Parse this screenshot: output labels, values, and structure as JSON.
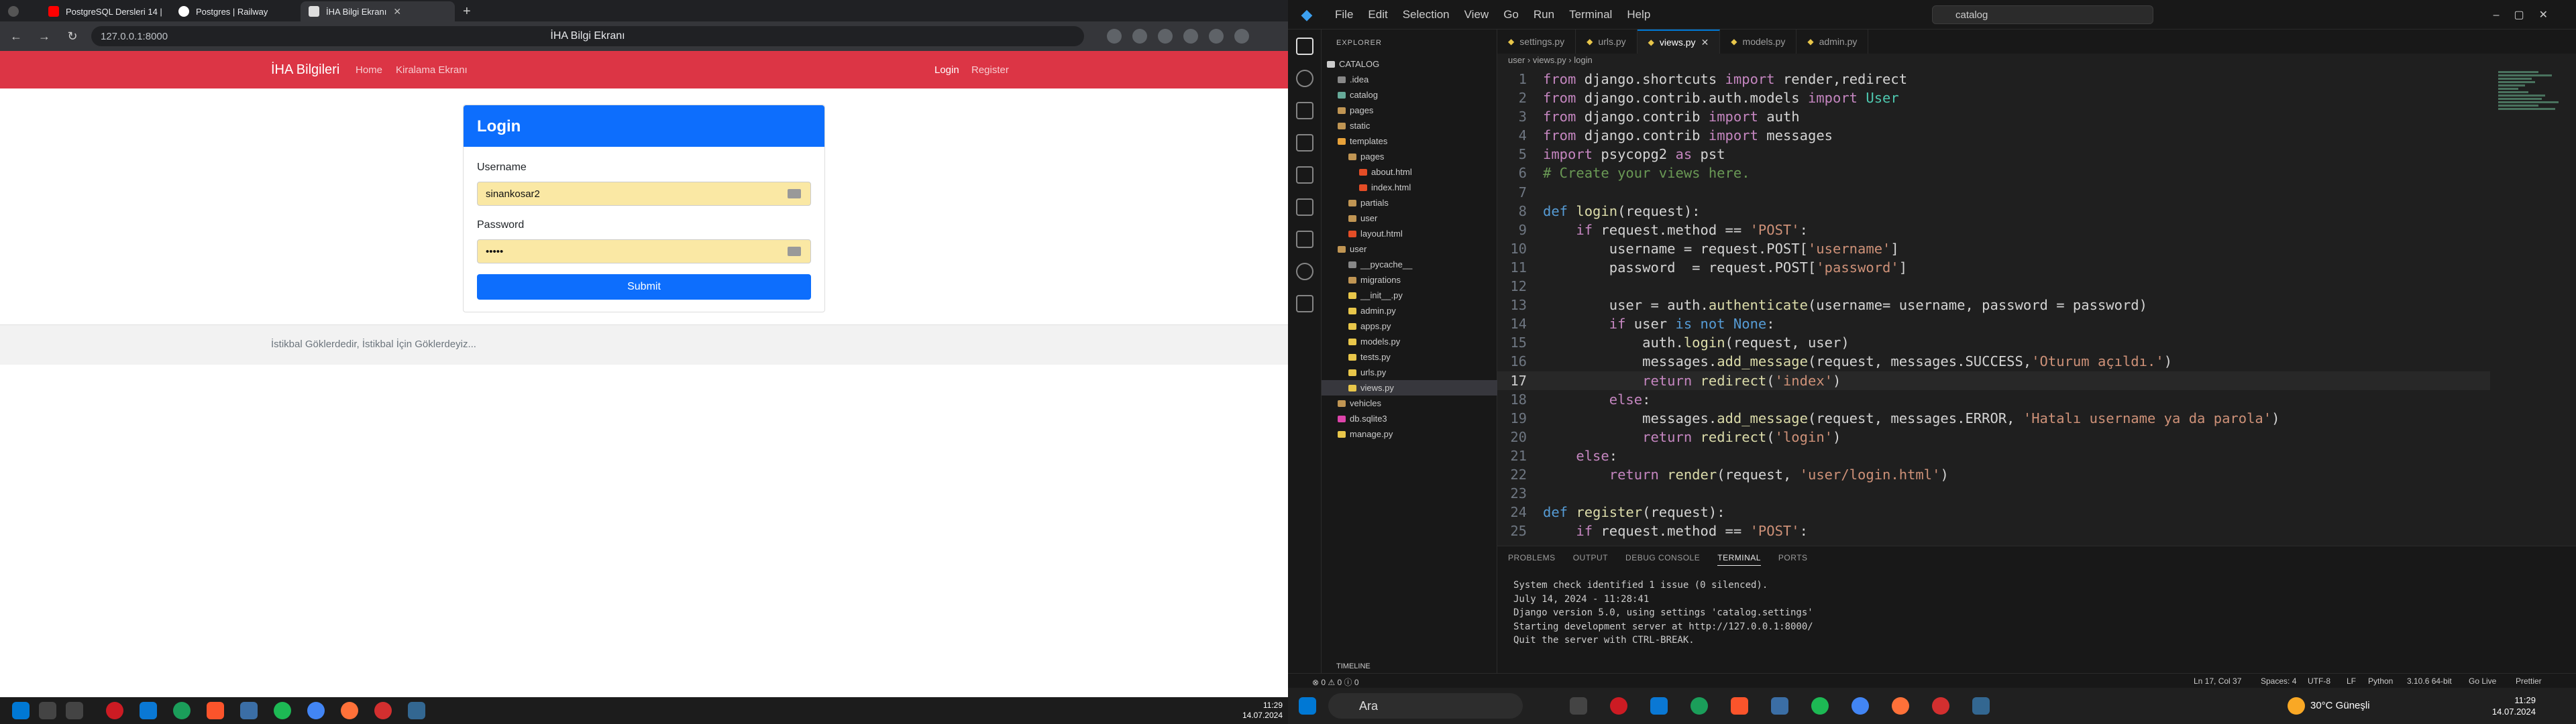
{
  "browser": {
    "tabs": [
      {
        "label": "PostgreSQL Dersleri 14 | D",
        "color": "#ff0000"
      },
      {
        "label": "Postgres | Railway",
        "color": "#ffffff"
      },
      {
        "label": "İHA Bilgi Ekranı",
        "color": "#ffffff"
      }
    ],
    "url": "127.0.0.1:8000",
    "page_title": "İHA Bilgi Ekranı"
  },
  "site": {
    "brand": "İHA Bilgileri",
    "nav": [
      "Home",
      "Kiralama Ekranı"
    ],
    "nav_right": [
      "Login",
      "Register"
    ],
    "card_title": "Login",
    "username_label": "Username",
    "username_value": "sinankosar2",
    "password_label": "Password",
    "password_value": "•••••",
    "submit": "Submit",
    "footer": "İstikbal Göklerdedir, İstikbal İçin Göklerdeyiz..."
  },
  "vscode": {
    "menu": [
      "File",
      "Edit",
      "Selection",
      "View",
      "Go",
      "Run",
      "Terminal",
      "Help"
    ],
    "search": "catalog",
    "explorer": "EXPLORER",
    "tree": [
      {
        "label": "CATALOG",
        "indent": 0,
        "c": "#ccc"
      },
      {
        "label": ".idea",
        "indent": 1,
        "c": "#888"
      },
      {
        "label": "catalog",
        "indent": 1,
        "c": "#6a9"
      },
      {
        "label": "pages",
        "indent": 1,
        "c": "#c09553"
      },
      {
        "label": "static",
        "indent": 1,
        "c": "#c09553"
      },
      {
        "label": "templates",
        "indent": 1,
        "c": "#e8a23a"
      },
      {
        "label": "pages",
        "indent": 2,
        "c": "#c09553"
      },
      {
        "label": "about.html",
        "indent": 3,
        "c": "#e44d26"
      },
      {
        "label": "index.html",
        "indent": 3,
        "c": "#e44d26"
      },
      {
        "label": "partials",
        "indent": 2,
        "c": "#c09553"
      },
      {
        "label": "user",
        "indent": 2,
        "c": "#c09553"
      },
      {
        "label": "layout.html",
        "indent": 2,
        "c": "#e44d26"
      },
      {
        "label": "user",
        "indent": 1,
        "c": "#c09553"
      },
      {
        "label": "__pycache__",
        "indent": 2,
        "c": "#888"
      },
      {
        "label": "migrations",
        "indent": 2,
        "c": "#c09553"
      },
      {
        "label": "__init__.py",
        "indent": 2,
        "c": "#e8c64a"
      },
      {
        "label": "admin.py",
        "indent": 2,
        "c": "#e8c64a"
      },
      {
        "label": "apps.py",
        "indent": 2,
        "c": "#e8c64a"
      },
      {
        "label": "models.py",
        "indent": 2,
        "c": "#e8c64a"
      },
      {
        "label": "tests.py",
        "indent": 2,
        "c": "#e8c64a"
      },
      {
        "label": "urls.py",
        "indent": 2,
        "c": "#e8c64a"
      },
      {
        "label": "views.py",
        "indent": 2,
        "c": "#e8c64a",
        "sel": true
      },
      {
        "label": "vehicles",
        "indent": 1,
        "c": "#c09553"
      },
      {
        "label": "db.sqlite3",
        "indent": 1,
        "c": "#d4a"
      },
      {
        "label": "manage.py",
        "indent": 1,
        "c": "#e8c64a"
      }
    ],
    "tabs": [
      {
        "label": "settings.py"
      },
      {
        "label": "urls.py"
      },
      {
        "label": "views.py",
        "active": true
      },
      {
        "label": "models.py"
      },
      {
        "label": "admin.py"
      }
    ],
    "breadcrumb": "user › views.py › login",
    "code": [
      [
        [
          "kw",
          "from"
        ],
        [
          "tx",
          " django.shortcuts "
        ],
        [
          "kw",
          "import"
        ],
        [
          "tx",
          " render,redirect"
        ]
      ],
      [
        [
          "kw",
          "from"
        ],
        [
          "tx",
          " django.contrib.auth.models "
        ],
        [
          "kw",
          "import"
        ],
        [
          "tx",
          " "
        ],
        [
          "cls",
          "User"
        ]
      ],
      [
        [
          "kw",
          "from"
        ],
        [
          "tx",
          " django.contrib "
        ],
        [
          "kw",
          "import"
        ],
        [
          "tx",
          " auth"
        ]
      ],
      [
        [
          "kw",
          "from"
        ],
        [
          "tx",
          " django.contrib "
        ],
        [
          "kw",
          "import"
        ],
        [
          "tx",
          " messages"
        ]
      ],
      [
        [
          "kw",
          "import"
        ],
        [
          "tx",
          " psycopg2 "
        ],
        [
          "kw",
          "as"
        ],
        [
          "tx",
          " pst"
        ]
      ],
      [
        [
          "cm",
          "# Create your views here."
        ]
      ],
      [
        [
          "tx",
          ""
        ]
      ],
      [
        [
          "kw2",
          "def"
        ],
        [
          "tx",
          " "
        ],
        [
          "fn",
          "login"
        ],
        [
          "tx",
          "(request):"
        ]
      ],
      [
        [
          "tx",
          "    "
        ],
        [
          "kw",
          "if"
        ],
        [
          "tx",
          " request.method == "
        ],
        [
          "st",
          "'POST'"
        ],
        [
          "tx",
          ":"
        ]
      ],
      [
        [
          "tx",
          "        username = request.POST["
        ],
        [
          "st",
          "'username'"
        ],
        [
          "tx",
          "]"
        ]
      ],
      [
        [
          "tx",
          "        password  = request.POST["
        ],
        [
          "st",
          "'password'"
        ],
        [
          "tx",
          "]"
        ]
      ],
      [
        [
          "tx",
          ""
        ]
      ],
      [
        [
          "tx",
          "        user = auth."
        ],
        [
          "fn",
          "authenticate"
        ],
        [
          "tx",
          "(username= username, password = password)"
        ]
      ],
      [
        [
          "tx",
          "        "
        ],
        [
          "kw",
          "if"
        ],
        [
          "tx",
          " user "
        ],
        [
          "kw2",
          "is not None"
        ],
        [
          "tx",
          ":"
        ]
      ],
      [
        [
          "tx",
          "            auth."
        ],
        [
          "fn",
          "login"
        ],
        [
          "tx",
          "(request, user)"
        ]
      ],
      [
        [
          "tx",
          "            messages."
        ],
        [
          "fn",
          "add_message"
        ],
        [
          "tx",
          "(request, messages.SUCCESS,"
        ],
        [
          "st",
          "'Oturum açıldı.'"
        ],
        [
          "tx",
          ")"
        ]
      ],
      [
        [
          "tx",
          "            "
        ],
        [
          "kw",
          "return"
        ],
        [
          "tx",
          " "
        ],
        [
          "fn",
          "redirect"
        ],
        [
          "tx",
          "("
        ],
        [
          "st",
          "'index'"
        ],
        [
          "tx",
          ")"
        ]
      ],
      [
        [
          "tx",
          "        "
        ],
        [
          "kw",
          "else"
        ],
        [
          "tx",
          ":"
        ]
      ],
      [
        [
          "tx",
          "            messages."
        ],
        [
          "fn",
          "add_message"
        ],
        [
          "tx",
          "(request, messages.ERROR, "
        ],
        [
          "st",
          "'Hatalı username ya da parola'"
        ],
        [
          "tx",
          ")"
        ]
      ],
      [
        [
          "tx",
          "            "
        ],
        [
          "kw",
          "return"
        ],
        [
          "tx",
          " "
        ],
        [
          "fn",
          "redirect"
        ],
        [
          "tx",
          "("
        ],
        [
          "st",
          "'login'"
        ],
        [
          "tx",
          ")"
        ]
      ],
      [
        [
          "tx",
          "    "
        ],
        [
          "kw",
          "else"
        ],
        [
          "tx",
          ":"
        ]
      ],
      [
        [
          "tx",
          "        "
        ],
        [
          "kw",
          "return"
        ],
        [
          "tx",
          " "
        ],
        [
          "fn",
          "render"
        ],
        [
          "tx",
          "(request, "
        ],
        [
          "st",
          "'user/login.html'"
        ],
        [
          "tx",
          ")"
        ]
      ],
      [
        [
          "tx",
          ""
        ]
      ],
      [
        [
          "kw2",
          "def"
        ],
        [
          "tx",
          " "
        ],
        [
          "fn",
          "register"
        ],
        [
          "tx",
          "(request):"
        ]
      ],
      [
        [
          "tx",
          "    "
        ],
        [
          "kw",
          "if"
        ],
        [
          "tx",
          " request.method == "
        ],
        [
          "st",
          "'POST'"
        ],
        [
          "tx",
          ":"
        ]
      ]
    ],
    "current_line": 17,
    "panel_tabs": [
      "PROBLEMS",
      "OUTPUT",
      "DEBUG CONSOLE",
      "TERMINAL",
      "PORTS"
    ],
    "terminal": "System check identified 1 issue (0 silenced).\nJuly 14, 2024 - 11:28:41\nDjango version 5.0, using settings 'catalog.settings'\nStarting development server at http://127.0.0.1:8000/\nQuit the server with CTRL-BREAK.",
    "timeline": "TIMELINE",
    "status": {
      "left": "⊗ 0 ⚠ 0  ⓘ 0",
      "pos": "Ln 17, Col 37",
      "spaces": "Spaces: 4",
      "enc": "UTF-8",
      "eol": "LF",
      "lang": "Python",
      "interp": "3.10.6 64-bit",
      "golive": "Go Live",
      "prettier": "Prettier"
    }
  },
  "taskbar": {
    "search": "Ara",
    "weather": "30°C  Güneşli",
    "time": "11:29",
    "date": "14.07.2024"
  }
}
